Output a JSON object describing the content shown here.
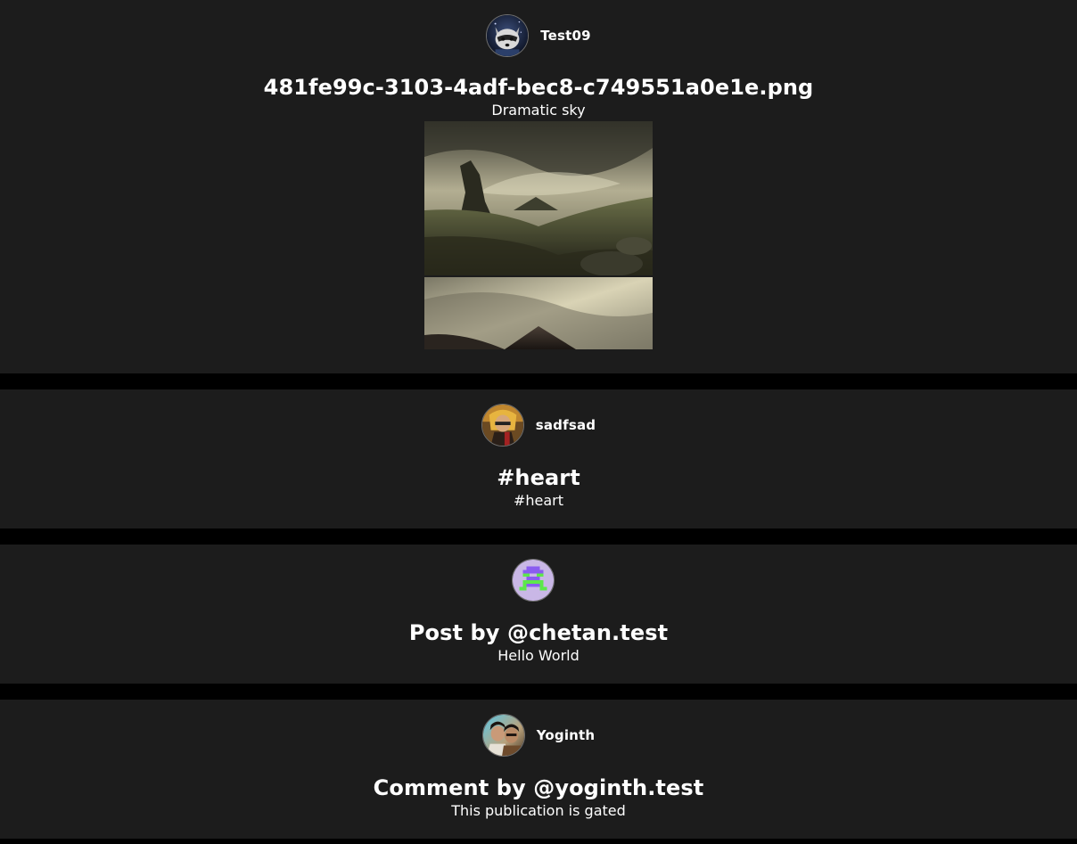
{
  "feed": {
    "posts": [
      {
        "username": "Test09",
        "avatar_icon": "raccoon-avatar-icon",
        "title": "481fe99c-3103-4adf-bec8-c749551a0e1e.png",
        "body": "Dramatic sky",
        "image": "dramatic-sky-landscape-image"
      },
      {
        "username": "sadfsad",
        "avatar_icon": "portrait-avatar-icon",
        "title": "#heart",
        "body": "#heart"
      },
      {
        "username": "",
        "avatar_icon": "pixel-robot-avatar-icon",
        "title": "Post by @chetan.test",
        "body": "Hello World"
      },
      {
        "username": "Yoginth",
        "avatar_icon": "photo-avatar-icon",
        "title": "Comment by @yoginth.test",
        "body": "This publication is gated"
      }
    ]
  },
  "colors": {
    "page_background": "#000000",
    "card_background": "#1c1c1c",
    "text": "#ffffff"
  }
}
